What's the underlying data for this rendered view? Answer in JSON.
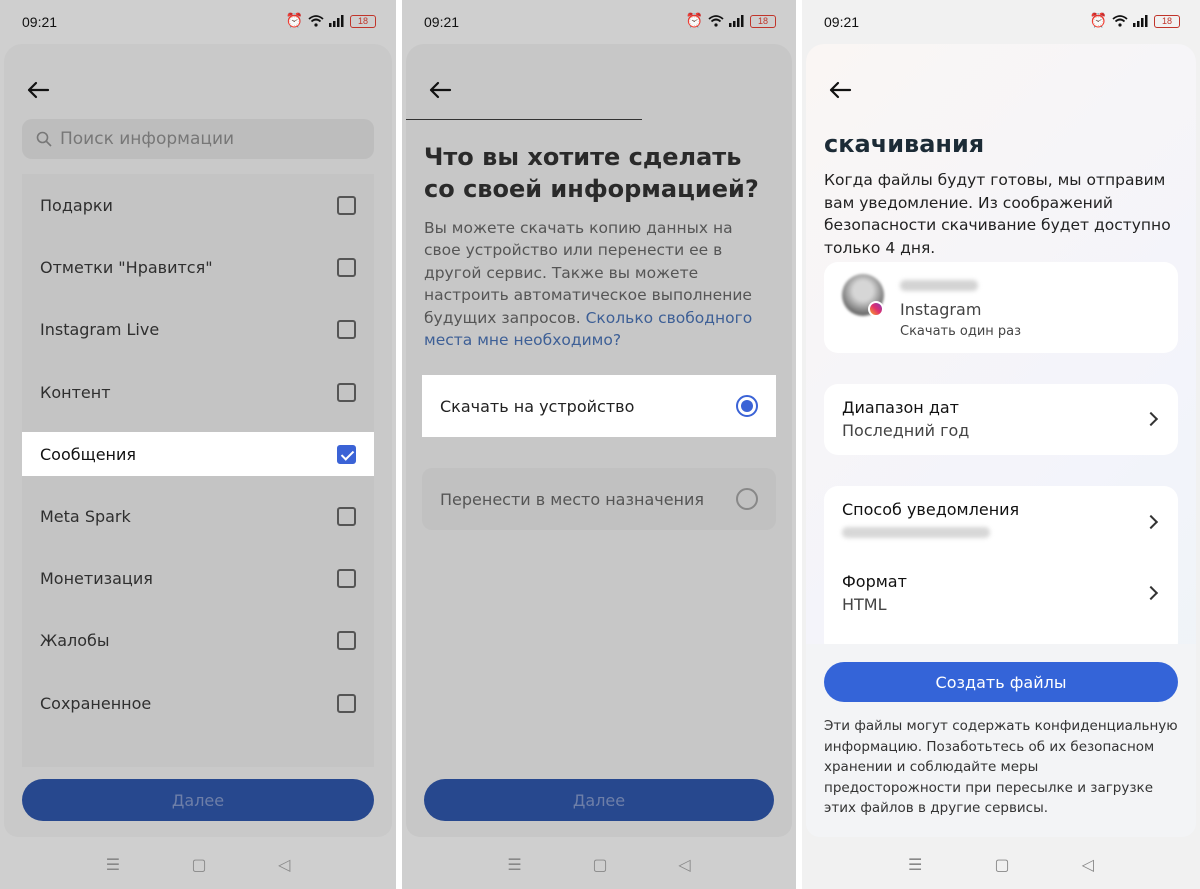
{
  "status": {
    "time": "09:21",
    "battery": "18"
  },
  "screen1": {
    "search_placeholder": "Поиск информации",
    "items": [
      {
        "label": "Подарки",
        "checked": false
      },
      {
        "label": "Отметки \"Нравится\"",
        "checked": false
      },
      {
        "label": "Instagram Live",
        "checked": false
      },
      {
        "label": "Контент",
        "checked": false
      },
      {
        "label": "Сообщения",
        "checked": true
      },
      {
        "label": "Meta Spark",
        "checked": false
      },
      {
        "label": "Монетизация",
        "checked": false
      },
      {
        "label": "Жалобы",
        "checked": false
      },
      {
        "label": "Сохраненное",
        "checked": false
      }
    ],
    "next_label": "Далее"
  },
  "screen2": {
    "title": "Что вы хотите сделать со своей информацией?",
    "description": "Вы можете скачать копию данных на свое устройство или перенести ее в другой сервис. Также вы можете настроить автоматическое выполнение будущих запросов.",
    "link": "Сколько свободного места мне необходимо?",
    "option_download": "Скачать на устройство",
    "option_transfer": "Перенести в место назначения",
    "next_label": "Далее"
  },
  "screen3": {
    "title": "скачивания",
    "description": "Когда файлы будут готовы, мы отправим вам уведомление. Из соображений безопасности скачивание будет доступно только 4 дня.",
    "account_app": "Instagram",
    "account_sub": "Скачать один раз",
    "date_range_label": "Диапазон дат",
    "date_range_value": "Последний год",
    "notify_label": "Способ уведомления",
    "format_label": "Формат",
    "format_value": "HTML",
    "create_label": "Создать файлы",
    "disclaimer": "Эти файлы могут содержать конфиденциальную информацию. Позаботьтесь об их безопасном хранении и соблюдайте меры предосторожности при пересылке и загрузке этих файлов в другие сервисы."
  }
}
